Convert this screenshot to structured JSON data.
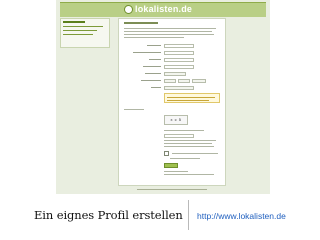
{
  "slide": {
    "caption": "Ein eignes Profil erstellen",
    "url": "http://www.lokalisten.de"
  },
  "screenshot": {
    "site_logo_text": "lokalisten.de",
    "captcha_text": "x c 5"
  },
  "colors": {
    "header_green": "#b9cf86",
    "page_background": "#e9eee0",
    "link_blue": "#1f5fbf",
    "notice_yellow": "#fff9dd",
    "button_green": "#9fc04f"
  }
}
